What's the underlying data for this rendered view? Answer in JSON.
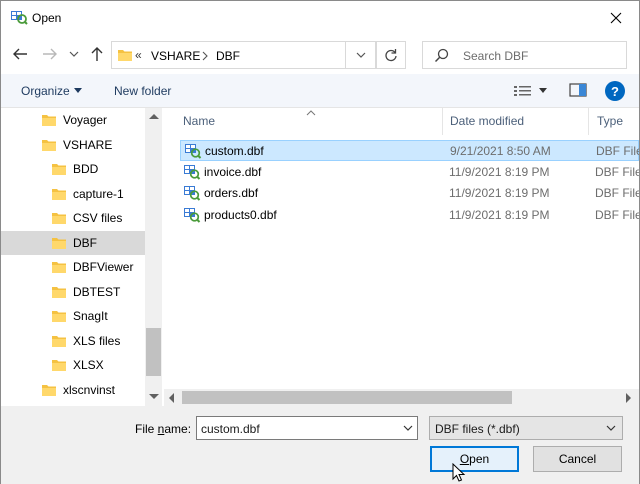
{
  "window": {
    "title": "Open"
  },
  "address": {
    "overflow": "«",
    "parts": [
      "VSHARE",
      "DBF"
    ]
  },
  "search": {
    "placeholder": "Search DBF"
  },
  "toolbar": {
    "organize": "Organize",
    "new_folder": "New folder",
    "help": "?"
  },
  "tree": [
    {
      "label": "Voyager",
      "selected": false
    },
    {
      "label": "VSHARE",
      "selected": false
    },
    {
      "label": "BDD",
      "selected": false
    },
    {
      "label": "capture-1",
      "selected": false
    },
    {
      "label": "CSV files",
      "selected": false
    },
    {
      "label": "DBF",
      "selected": true
    },
    {
      "label": "DBFViewer",
      "selected": false
    },
    {
      "label": "DBTEST",
      "selected": false
    },
    {
      "label": "SnagIt",
      "selected": false
    },
    {
      "label": "XLS files",
      "selected": false
    },
    {
      "label": "XLSX",
      "selected": false
    },
    {
      "label": "xlscnvinst",
      "selected": false
    }
  ],
  "columns": {
    "name": "Name",
    "date": "Date modified",
    "type": "Type"
  },
  "files": [
    {
      "name": "custom.dbf",
      "date": "9/21/2021 8:50 AM",
      "type": "DBF File",
      "selected": true
    },
    {
      "name": "invoice.dbf",
      "date": "11/9/2021 8:19 PM",
      "type": "DBF File",
      "selected": false
    },
    {
      "name": "orders.dbf",
      "date": "11/9/2021 8:19 PM",
      "type": "DBF File",
      "selected": false
    },
    {
      "name": "products0.dbf",
      "date": "11/9/2021 8:19 PM",
      "type": "DBF File",
      "selected": false
    }
  ],
  "filename": {
    "label_prefix": "File ",
    "label_accel": "n",
    "label_suffix": "ame:",
    "value": "custom.dbf"
  },
  "filetype": {
    "selected": "DBF files (*.dbf)"
  },
  "buttons": {
    "open_accel": "O",
    "open_rest": "pen",
    "cancel": "Cancel"
  },
  "colors": {
    "folder": "#f5c242",
    "selection": "#cce8ff",
    "accent": "#0078d7",
    "help": "#0067c0"
  }
}
